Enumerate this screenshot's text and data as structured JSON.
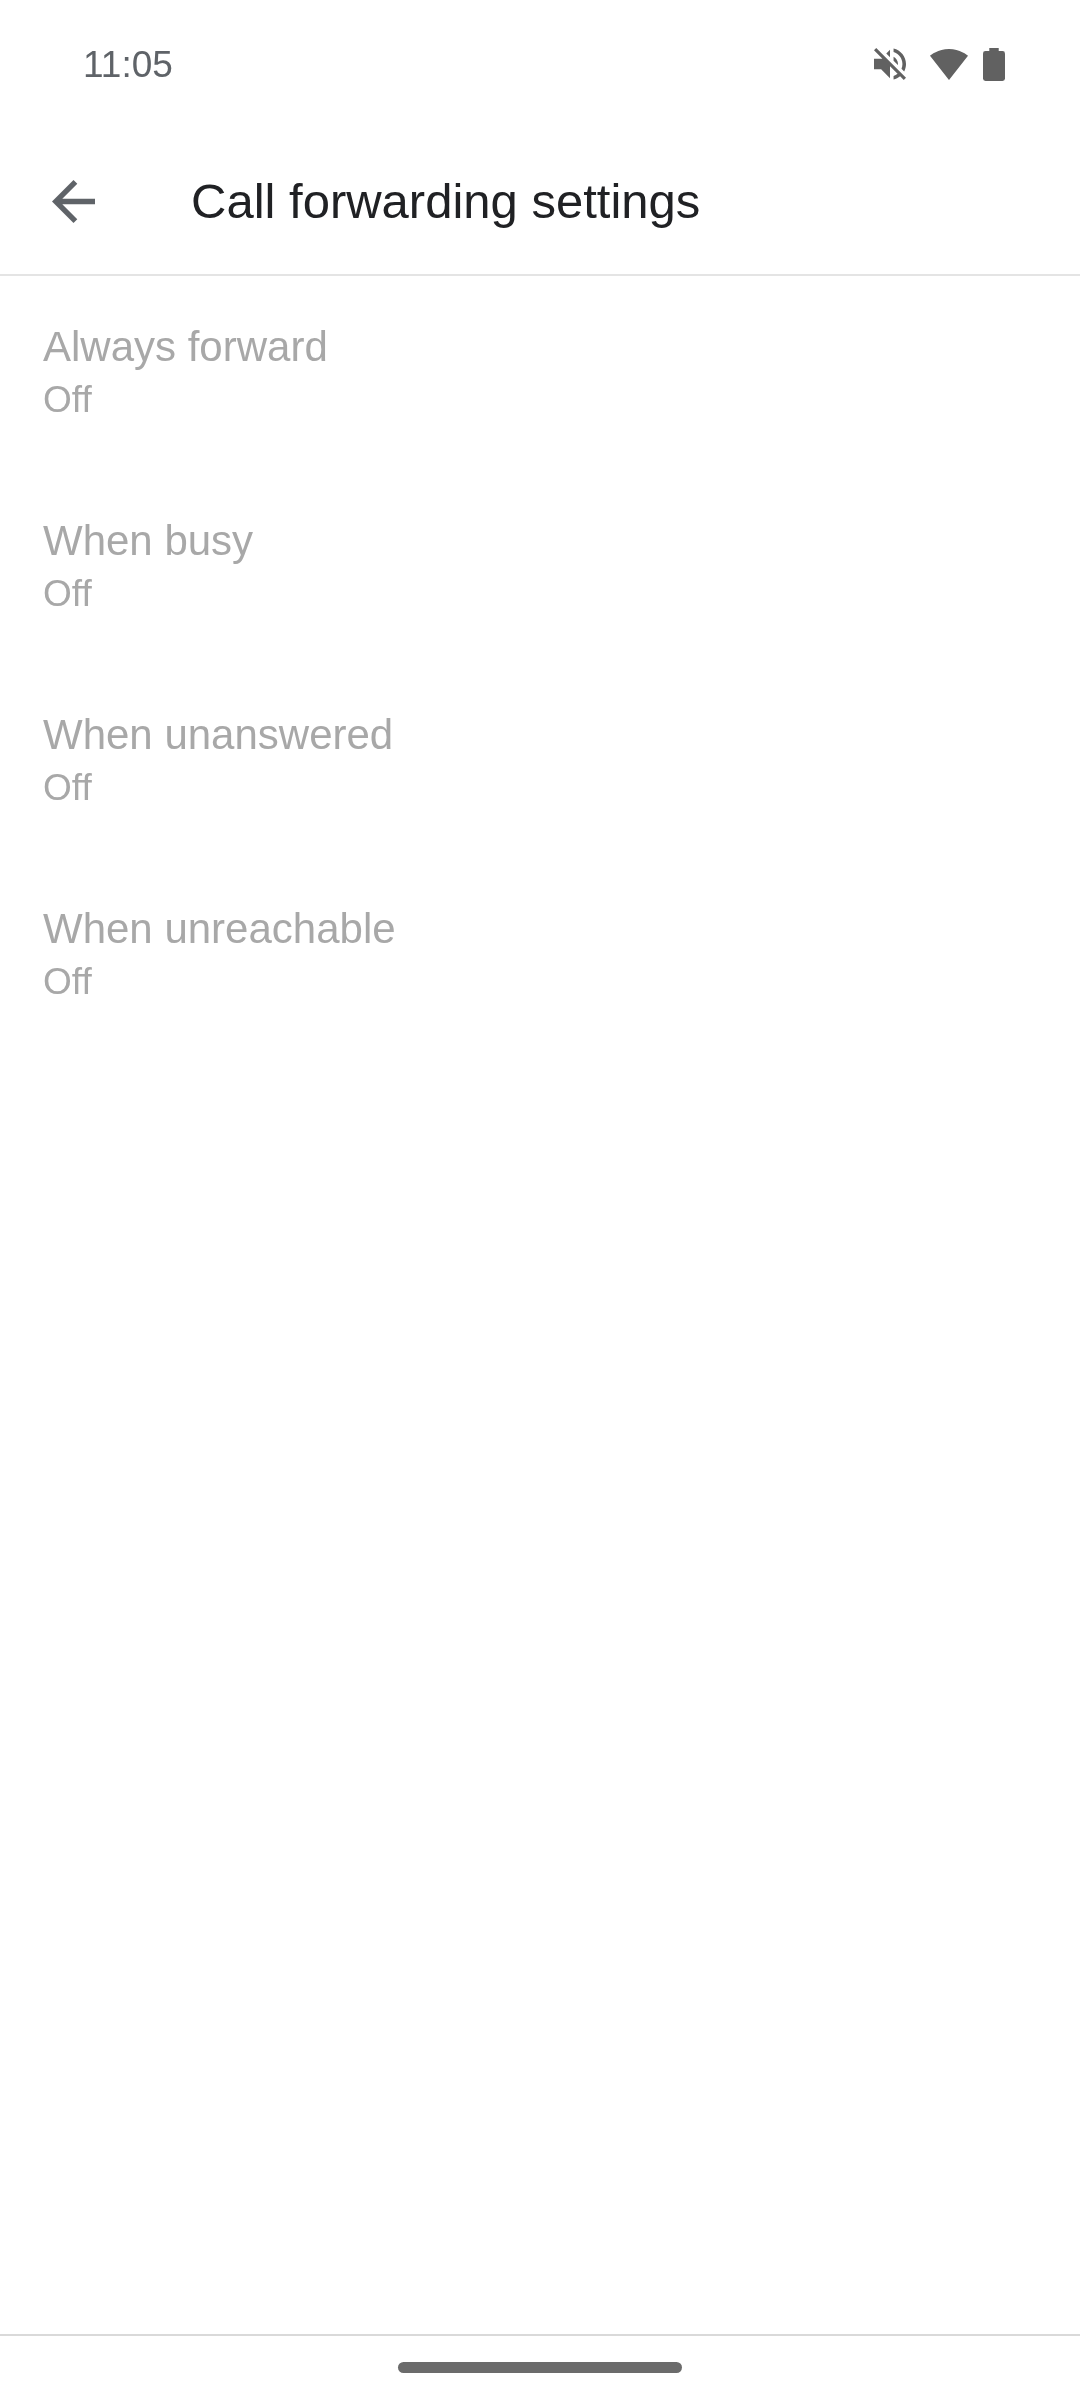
{
  "status_bar": {
    "time": "11:05"
  },
  "toolbar": {
    "title": "Call forwarding settings"
  },
  "items": [
    {
      "title": "Always forward",
      "summary": "Off",
      "disabled": true
    },
    {
      "title": "When busy",
      "summary": "Off",
      "disabled": true
    },
    {
      "title": "When unanswered",
      "summary": "Off",
      "disabled": true
    },
    {
      "title": "When unreachable",
      "summary": "Off",
      "disabled": true
    }
  ]
}
